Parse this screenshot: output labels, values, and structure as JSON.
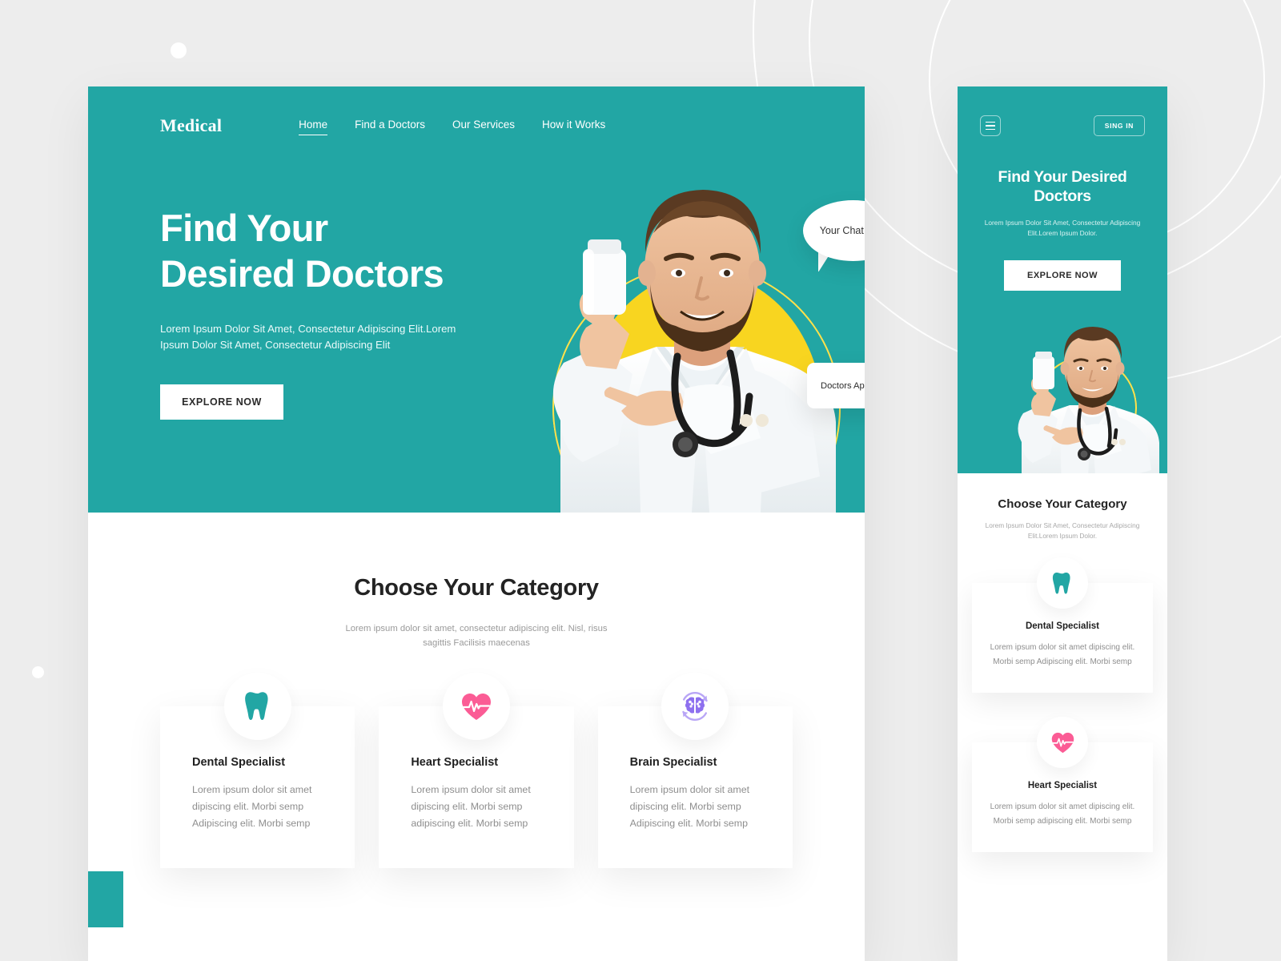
{
  "brand": {
    "name": "Medical",
    "accent_color": "#22a6a4",
    "yellow": "#f8d520",
    "pink": "#fb5c95",
    "purple": "#8e70ef"
  },
  "nav": {
    "items": [
      {
        "label": "Home",
        "active": true
      },
      {
        "label": "Find a Doctors",
        "active": false
      },
      {
        "label": "Our Services",
        "active": false
      },
      {
        "label": "How it Works",
        "active": false
      }
    ]
  },
  "hero": {
    "title_line1": "Find Your",
    "title_line2": "Desired Doctors",
    "subtitle": "Lorem Ipsum Dolor Sit Amet, Consectetur Adipiscing Elit.Lorem Ipsum Dolor Sit Amet, Consectetur Adipiscing Elit",
    "cta": "EXPLORE NOW",
    "chat_bubble": "Your Chat here",
    "appointment_label": "Doctors Appointment",
    "appointment_icon": "play-triangle-icon"
  },
  "category": {
    "title": "Choose Your Category",
    "subtitle": "Lorem ipsum dolor sit amet, consectetur adipiscing elit. Nisl, risus sagittis Facilisis maecenas",
    "cards": [
      {
        "icon": "tooth-icon",
        "icon_color": "#22a6a4",
        "title": "Dental Specialist",
        "text": "Lorem ipsum dolor sit amet dipiscing elit. Morbi semp Adipiscing elit. Morbi semp"
      },
      {
        "icon": "heart-pulse-icon",
        "icon_color": "#fb5c95",
        "title": "Heart Specialist",
        "text": "Lorem ipsum dolor sit amet dipiscing elit. Morbi semp adipiscing elit. Morbi semp"
      },
      {
        "icon": "brain-refresh-icon",
        "icon_color": "#8e70ef",
        "title": "Brain Specialist",
        "text": "Lorem ipsum dolor sit amet dipiscing elit. Morbi semp Adipiscing elit. Morbi semp"
      }
    ]
  },
  "mobile": {
    "menu_icon": "hamburger-icon",
    "signin_label": "SING IN",
    "title": "Find Your Desired Doctors",
    "subtitle": "Lorem Ipsum Dolor Sit Amet, Consectetur Adipiscing Elit.Lorem Ipsum Dolor.",
    "cta": "EXPLORE NOW",
    "category_title": "Choose Your Category",
    "category_subtitle": "Lorem Ipsum Dolor Sit Amet, Consectetur Adipiscing Elit.Lorem Ipsum Dolor.",
    "cards": [
      {
        "icon": "tooth-icon",
        "title": "Dental Specialist",
        "text": "Lorem ipsum dolor sit amet dipiscing elit. Morbi semp Adipiscing elit. Morbi semp"
      },
      {
        "icon": "heart-pulse-icon",
        "title": "Heart Specialist",
        "text": "Lorem ipsum dolor sit amet dipiscing elit. Morbi semp adipiscing elit. Morbi semp"
      }
    ]
  }
}
